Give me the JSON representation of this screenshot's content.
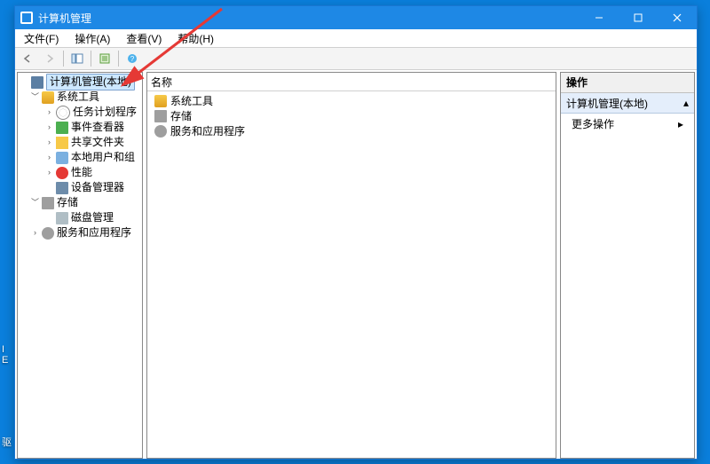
{
  "window": {
    "title": "计算机管理"
  },
  "menu": {
    "file": "文件(F)",
    "action": "操作(A)",
    "view": "查看(V)",
    "help": "帮助(H)"
  },
  "tree": {
    "root": "计算机管理(本地)",
    "sys_tools": "系统工具",
    "task_sched": "任务计划程序",
    "event_viewer": "事件查看器",
    "shared_folders": "共享文件夹",
    "local_users": "本地用户和组",
    "performance": "性能",
    "device_mgr": "设备管理器",
    "storage": "存储",
    "disk_mgmt": "磁盘管理",
    "services_apps": "服务和应用程序"
  },
  "list": {
    "header_name": "名称",
    "items": {
      "sys_tools": "系统工具",
      "storage": "存储",
      "services_apps": "服务和应用程序"
    }
  },
  "right": {
    "header": "操作",
    "subheader": "计算机管理(本地)",
    "more_actions": "更多操作"
  },
  "desktop": {
    "i": "I",
    "e": "E",
    "bottom": "驱"
  }
}
